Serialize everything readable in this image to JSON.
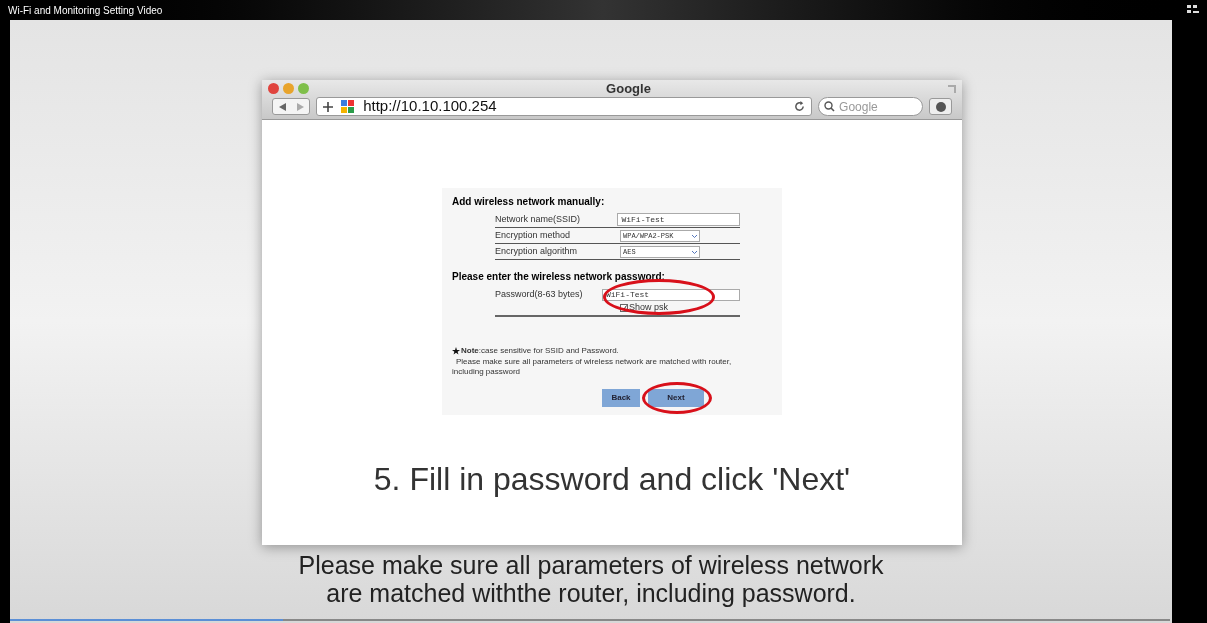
{
  "video": {
    "title": "Wi-Fi and Monitoring Setting Video",
    "progress": {
      "level": 0.235
    }
  },
  "browser": {
    "title": "Google",
    "url": "http://10.10.100.254",
    "search_placeholder": "Google"
  },
  "form": {
    "heading": "Add wireless network manually:",
    "fields": [
      {
        "label": "Network name(SSID)",
        "kind": "text",
        "value": "WiFi-Test"
      },
      {
        "label": "Encryption method",
        "kind": "select",
        "value": "WPA/WPA2-PSK"
      },
      {
        "label": "Encryption algorithm",
        "kind": "select",
        "value": "AES"
      }
    ],
    "password_heading": "Please enter the wireless network password:",
    "password": {
      "label": "Password(8-63 bytes)",
      "value": "WiFi-Test",
      "highlighted": true
    },
    "show_psk": {
      "label": "Show psk",
      "checked": true
    },
    "note": "**Note**:case sensitive for SSID and Password.",
    "note_detail": "Please make sure all parameters of wireless network are matched with router, including password",
    "buttons": [
      {
        "label": "Back",
        "highlighted": false
      },
      {
        "label": "Next",
        "highlighted": true
      }
    ]
  },
  "caption": "5. Fill in password and click 'Next'",
  "subtitles": [
    "Please make sure all parameters of wireless network",
    "are matched withthe router, including password."
  ]
}
